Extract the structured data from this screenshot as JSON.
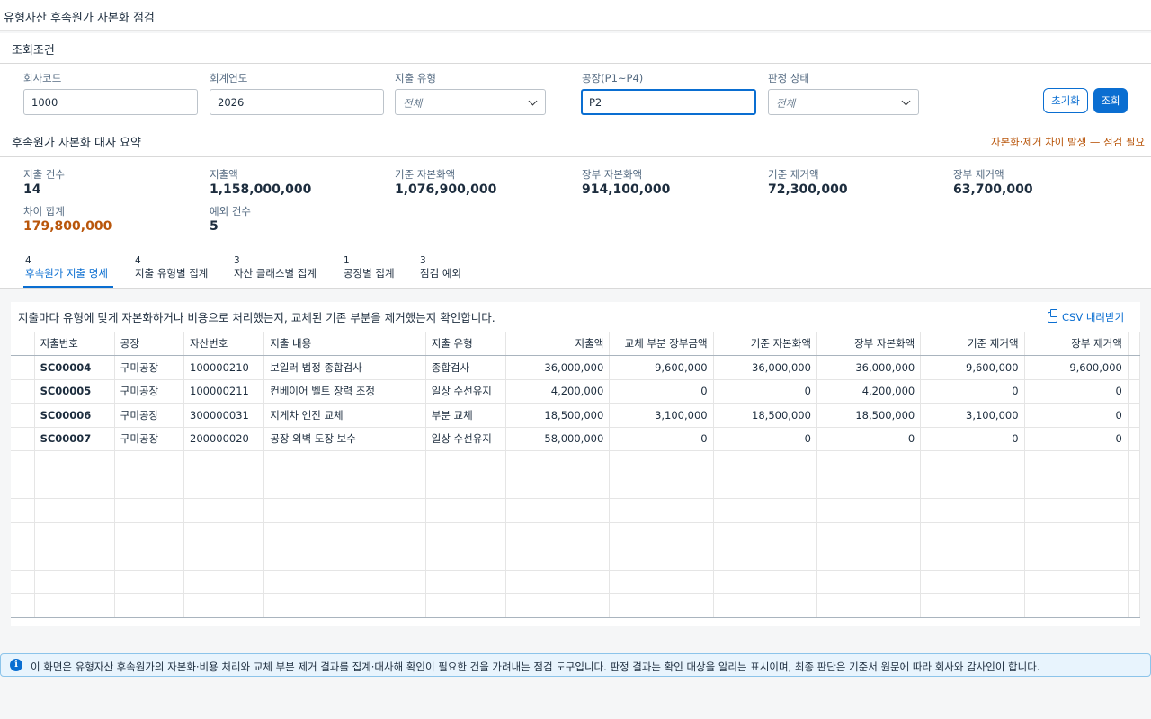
{
  "page": {
    "title": "유형자산 후속원가 자본화 점검"
  },
  "filters": {
    "title": "조회조건",
    "company_code": {
      "label": "회사코드",
      "value": "1000"
    },
    "fiscal_year": {
      "label": "회계연도",
      "value": "2026"
    },
    "spend_type": {
      "label": "지출 유형",
      "value": "전체"
    },
    "plant": {
      "label": "공장(P1~P4)",
      "value": "P2"
    },
    "judgment": {
      "label": "판정 상태",
      "value": "전체"
    },
    "reset_label": "초기화",
    "search_label": "조회"
  },
  "summary": {
    "title": "후속원가 자본화 대사 요약",
    "warning": "자본화·제거 차이 발생 — 점검 필요",
    "items": [
      {
        "label": "지출 건수",
        "value": "14"
      },
      {
        "label": "지출액",
        "value": "1,158,000,000"
      },
      {
        "label": "기준 자본화액",
        "value": "1,076,900,000"
      },
      {
        "label": "장부 자본화액",
        "value": "914,100,000"
      },
      {
        "label": "기준 제거액",
        "value": "72,300,000"
      },
      {
        "label": "장부 제거액",
        "value": "63,700,000"
      },
      {
        "label": "차이 합계",
        "value": "179,800,000"
      },
      {
        "label": "예외 건수",
        "value": "5"
      }
    ]
  },
  "tabs": [
    {
      "count": "4",
      "label": "후속원가 지출 명세",
      "active": true
    },
    {
      "count": "4",
      "label": "지출 유형별 집계"
    },
    {
      "count": "3",
      "label": "자산 클래스별 집계"
    },
    {
      "count": "1",
      "label": "공장별 집계"
    },
    {
      "count": "3",
      "label": "점검 예외"
    }
  ],
  "table": {
    "description": "지출마다 유형에 맞게 자본화하거나 비용으로 처리했는지, 교체된 기존 부분을 제거했는지 확인합니다.",
    "csv_label": "CSV 내려받기",
    "columns": [
      "지출번호",
      "공장",
      "자산번호",
      "지출 내용",
      "지출 유형",
      "지출액",
      "교체 부분 장부금액",
      "기준 자본화액",
      "장부 자본화액",
      "기준 제거액",
      "장부 제거액"
    ],
    "rows": [
      [
        "SC00004",
        "구미공장",
        "100000210",
        "보일러 법정 종합검사",
        "종합검사",
        "36,000,000",
        "9,600,000",
        "36,000,000",
        "36,000,000",
        "9,600,000",
        "9,600,000"
      ],
      [
        "SC00005",
        "구미공장",
        "100000211",
        "컨베이어 벨트 장력 조정",
        "일상 수선유지",
        "4,200,000",
        "0",
        "0",
        "4,200,000",
        "0",
        "0"
      ],
      [
        "SC00006",
        "구미공장",
        "300000031",
        "지게차 엔진 교체",
        "부분 교체",
        "18,500,000",
        "3,100,000",
        "18,500,000",
        "18,500,000",
        "3,100,000",
        "0"
      ],
      [
        "SC00007",
        "구미공장",
        "200000020",
        "공장 외벽 도장 보수",
        "일상 수선유지",
        "58,000,000",
        "0",
        "0",
        "0",
        "0",
        "0"
      ]
    ]
  },
  "info": {
    "icon": "info-icon",
    "text": "이 화면은 유형자산 후속원가의 자본화·비용 처리와 교체 부분 제거 결과를 집계·대사해 확인이 필요한 건을 가려내는 점검 도구입니다. 판정 결과는 확인 대상을 알리는 표시이며, 최종 판단은 기준서 원문에 따라 회사와 감사인이 합니다."
  },
  "colors": {
    "accent": "#0a6ed1",
    "warning": "#b9560b",
    "info_bg": "#e8f4fd"
  }
}
